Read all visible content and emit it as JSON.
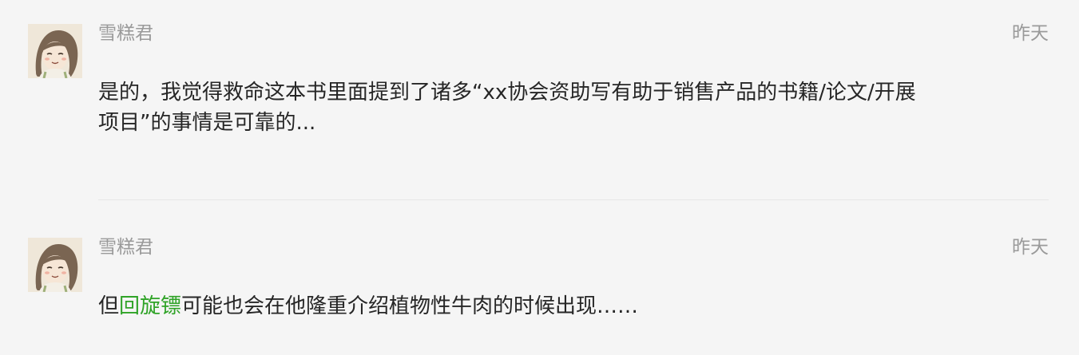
{
  "comments": [
    {
      "author": "雪糕君",
      "time": "昨天",
      "text": "是的，我觉得救命这本书里面提到了诸多“xx协会资助写有助于销售产品的书籍/论文/开展项目”的事情是可靠的..."
    },
    {
      "author": "雪糕君",
      "time": "昨天",
      "text_before": "但",
      "link_text": "回旋镖",
      "text_after": "可能也会在他隆重介绍植物性牛肉的时候出现……",
      "link_color": "#2fa327"
    }
  ],
  "icons": {
    "avatar": "cartoon-girl-avatar-icon"
  },
  "colors": {
    "background": "#f5f5f5",
    "meta_text": "#9a9a9a",
    "body_text": "#262626",
    "link": "#2fa327",
    "divider": "#e6e6e6"
  }
}
